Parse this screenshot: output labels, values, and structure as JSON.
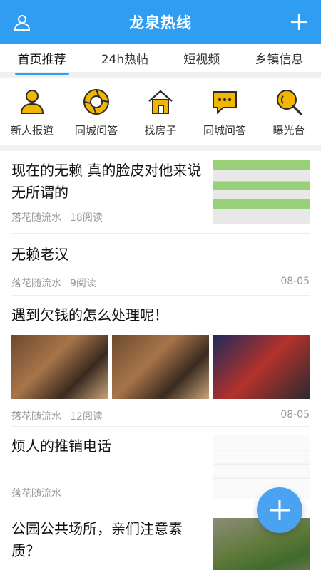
{
  "header": {
    "title": "龙泉热线",
    "user_icon": "user-icon",
    "add_icon": "plus-icon"
  },
  "tabs": [
    {
      "label": "首页推荐",
      "active": true
    },
    {
      "label": "24h热帖",
      "active": false
    },
    {
      "label": "短视频",
      "active": false
    },
    {
      "label": "乡镇信息",
      "active": false
    }
  ],
  "quick": [
    {
      "label": "新人报道",
      "icon": "person-icon"
    },
    {
      "label": "同城问答",
      "icon": "camera-aperture-icon"
    },
    {
      "label": "找房子",
      "icon": "house-icon"
    },
    {
      "label": "同城问答",
      "icon": "chat-bubble-icon"
    },
    {
      "label": "曝光台",
      "icon": "magnifier-icon"
    }
  ],
  "posts": [
    {
      "title": "现在的无赖 真的脸皮对他来说无所谓的",
      "author": "落花随流水",
      "reads": "18阅读",
      "date": ""
    },
    {
      "title": "无赖老汉",
      "author": "落花随流水",
      "reads": "9阅读",
      "date": "08-05"
    },
    {
      "title": "遇到欠钱的怎么处理呢！",
      "author": "落花随流水",
      "reads": "12阅读",
      "date": "08-05"
    },
    {
      "title": "烦人的推销电话",
      "author": "落花随流水",
      "reads": "",
      "date": ""
    },
    {
      "title": "公园公共场所，亲们注意素质？",
      "author": "",
      "reads": "",
      "date": ""
    }
  ],
  "colors": {
    "brand": "#2f9ef2",
    "icon_yellow": "#f2b600",
    "icon_dark": "#2b2b2b"
  },
  "fab_icon": "plus-icon"
}
